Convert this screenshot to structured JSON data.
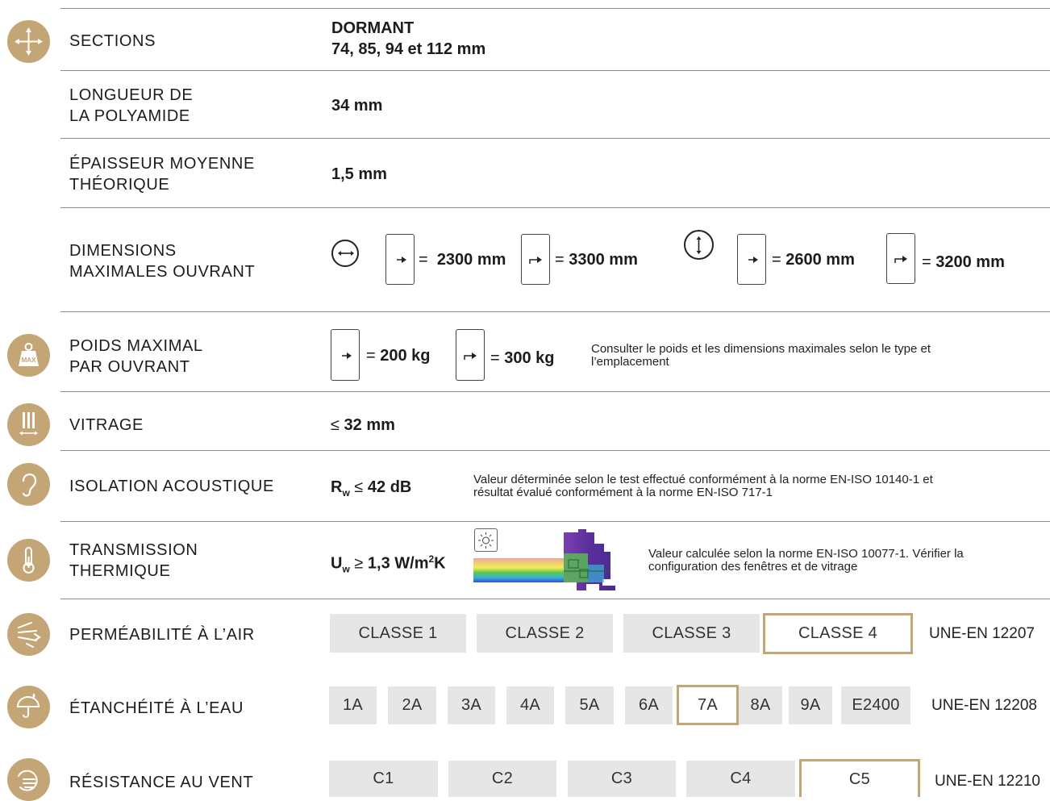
{
  "colors": {
    "accent": "#c4a676",
    "rule": "#8a8a8a",
    "pill": "#e6e6e6"
  },
  "rows": {
    "sections": {
      "label1": "SECTIONS",
      "value1": "DORMANT",
      "value2": "74, 85, 94 et 112 mm",
      "icon": "move-arrows-icon"
    },
    "polyamide": {
      "label1": "LONGUEUR DE",
      "label2": "LA POLYAMIDE",
      "value": "34 mm"
    },
    "thickness": {
      "label1": "ÉPAISSEUR MOYENNE",
      "label2": "THÉORIQUE",
      "value": "1,5 mm"
    },
    "dimensions": {
      "label1": "DIMENSIONS",
      "label2": "MAXIMALES OUVRANT",
      "width_a": "2300 mm",
      "width_b": "3300 mm",
      "height_a": "2600 mm",
      "height_b": "3200 mm",
      "eq": "="
    },
    "weight": {
      "label1": "POIDS MAXIMAL",
      "label2": "PAR OUVRANT",
      "icon_text": "MAX",
      "a": "200 kg",
      "b": "300 kg",
      "eq": "=",
      "note1": "Consulter le poids et les dimensions maximales selon le type et",
      "note2": "l’emplacement"
    },
    "glazing": {
      "label": "VITRAGE",
      "prefix": "≤",
      "value": "32 mm"
    },
    "acoustic": {
      "label": "ISOLATION ACOUSTIQUE",
      "sym": "R",
      "sub": "w",
      "rel": "≤",
      "value": "42 dB",
      "note1": "Valeur déterminée selon le test effectué conformément à la norme EN-ISO 10140-1 et",
      "note2": "résultat évalué conformément à la norme EN-ISO 717-1"
    },
    "thermal": {
      "label1": "TRANSMISSION",
      "label2": "THERMIQUE",
      "sym": "U",
      "sub": "w",
      "rel": "≥",
      "value_num": "1,3 W/m",
      "value_exp": "2",
      "value_unit": "K",
      "note1": "Valeur calculée selon la norme EN-ISO 10077-1. Vérifier la",
      "note2": "configuration des fenêtres et de vitrage"
    },
    "air": {
      "label": "PERMÉABILITÉ À L’AIR",
      "classes": [
        "CLASSE 1",
        "CLASSE 2",
        "CLASSE 3",
        "CLASSE 4"
      ],
      "selected": "CLASSE 4",
      "standard": "UNE-EN 12207"
    },
    "water": {
      "label": "ÉTANCHÉITÉ À L’EAU",
      "classes": [
        "1A",
        "2A",
        "3A",
        "4A",
        "5A",
        "6A",
        "7A",
        "8A",
        "9A",
        "E2400"
      ],
      "selected": "7A",
      "standard": "UNE-EN 12208"
    },
    "wind": {
      "label": "RÉSISTANCE AU VENT",
      "classes": [
        "C1",
        "C2",
        "C3",
        "C4",
        "C5"
      ],
      "selected": "C5",
      "standard": "UNE-EN 12210"
    }
  }
}
